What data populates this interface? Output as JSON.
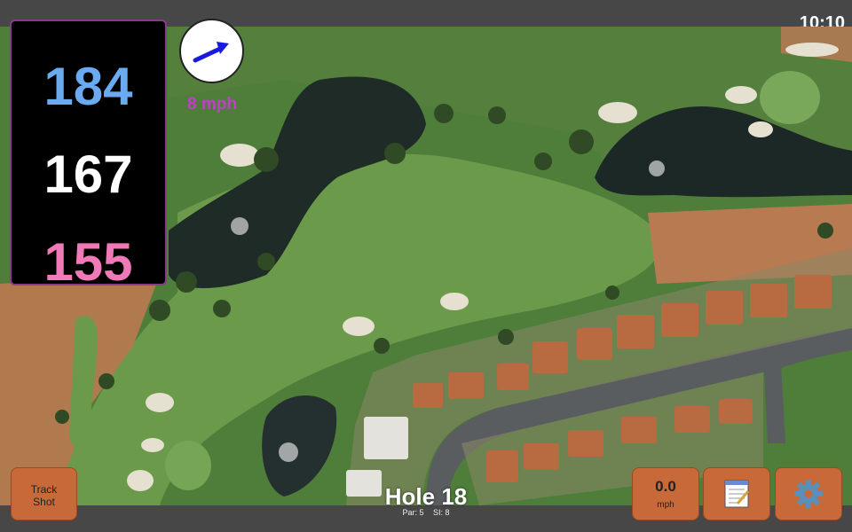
{
  "status_bar": {
    "time": "10:10"
  },
  "distances": {
    "back": {
      "value": "184",
      "color": "#6aaaf0"
    },
    "middle": {
      "value": "167",
      "color": "#ffffff"
    },
    "front": {
      "value": "155",
      "color": "#f07ab8"
    }
  },
  "wind": {
    "arrow_icon": "arrow-right-icon",
    "speed_label": "8 mph"
  },
  "hole": {
    "title": "Hole 18",
    "par": "Par: 5",
    "si": "SI: 8"
  },
  "buttons": {
    "track_shot_line1": "Track",
    "track_shot_line2": "Shot",
    "wind_value": "0.0",
    "wind_unit": "mph",
    "notes_icon": "notepad-icon",
    "settings_icon": "gear-icon"
  }
}
